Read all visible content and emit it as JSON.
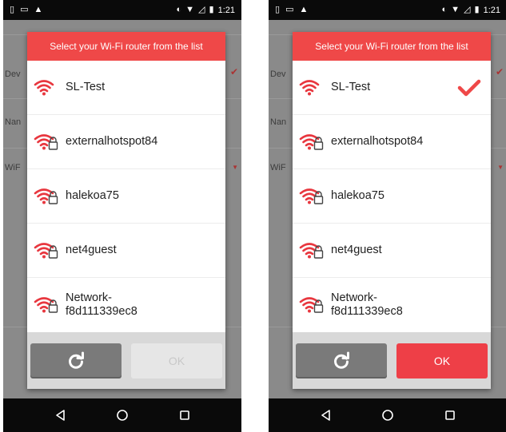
{
  "status_bar": {
    "time": "1:21"
  },
  "background_screen": {
    "labels": [
      "Dev",
      "Nan",
      "WiF"
    ]
  },
  "dialog": {
    "title": "Select your Wi-Fi router from the list",
    "networks": [
      "SL-Test",
      "externalhotspot84",
      "halekoa75",
      "net4guest",
      "Network-f8d111339ec8"
    ],
    "network_lines": [
      [
        "SL-Test"
      ],
      [
        "externalhotspot84"
      ],
      [
        "halekoa75"
      ],
      [
        "net4guest"
      ],
      [
        "Network-",
        "f8d111339ec8"
      ]
    ],
    "network_secured": [
      false,
      true,
      true,
      true,
      true
    ],
    "ok_label": "OK",
    "refresh_icon": "refresh-icon"
  },
  "screens": [
    {
      "name": "before-selection",
      "selected_network": null,
      "ok_enabled": false
    },
    {
      "name": "after-selection",
      "selected_network": "SL-Test",
      "ok_enabled": true
    }
  ],
  "colors": {
    "accent": "#ef4848",
    "ok_enabled": "#ee3f47",
    "ok_disabled": "#e6e6e6",
    "wifi_icon": "#e8373f",
    "dim_overlay": "#7d7d7d"
  },
  "nav_icons": [
    "back-icon",
    "home-icon",
    "recents-icon"
  ]
}
